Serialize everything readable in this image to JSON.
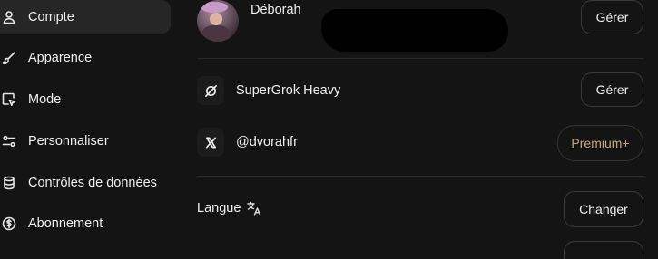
{
  "sidebar": {
    "items": [
      {
        "label": "Compte",
        "icon": "user-icon",
        "active": true
      },
      {
        "label": "Apparence",
        "icon": "brush-icon",
        "active": false
      },
      {
        "label": "Mode",
        "icon": "cursor-window-icon",
        "active": false
      },
      {
        "label": "Personnaliser",
        "icon": "sliders-icon",
        "active": false
      },
      {
        "label": "Contrôles de données",
        "icon": "database-icon",
        "active": false
      },
      {
        "label": "Abonnement",
        "icon": "dollar-circle-icon",
        "active": false
      }
    ]
  },
  "account": {
    "user_name": "Déborah",
    "manage_label": "Gérer"
  },
  "subscription": {
    "plan_name": "SuperGrok Heavy",
    "manage_label": "Gérer"
  },
  "x_account": {
    "handle": "@dvorahfr",
    "premium_label": "Premium+"
  },
  "language": {
    "label": "Langue",
    "change_label": "Changer"
  },
  "colors": {
    "background": "#141414",
    "active_item": "#262626",
    "premium_text": "#c7a781"
  }
}
